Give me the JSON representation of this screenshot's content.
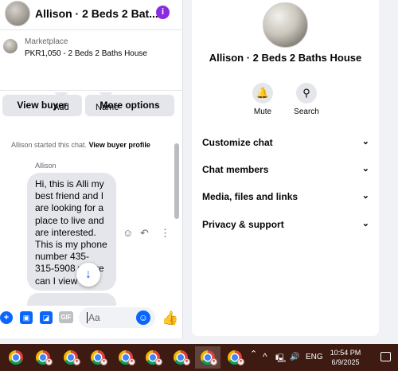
{
  "chat": {
    "title": "Allison · 2 Beds 2 Bat...",
    "listing_label": "Marketplace",
    "listing_text": "PKR1,050 - 2 Beds 2 Baths House",
    "view_buyer": "View buyer",
    "more_options": "More options",
    "add_label": "Add",
    "name_label": "Name",
    "system_text": "Allison started this chat.",
    "system_link": "View buyer profile",
    "sender": "Allison",
    "message": "Hi, this is Alli my best friend and I are looking for a place to live and are interested. This is my phone number 435-315-5908 where can I view it?!",
    "input_placeholder": "Aa",
    "gif_label": "GIF"
  },
  "info": {
    "title": "Allison · 2 Beds 2 Baths House",
    "mute": "Mute",
    "search": "Search",
    "sections": [
      "Customize chat",
      "Chat members",
      "Media, files and links",
      "Privacy & support"
    ]
  },
  "taskbar": {
    "language": "ENG",
    "time": "10:54 PM",
    "date": "6/9/2025"
  },
  "colors": {
    "accent": "#0866ff",
    "info_icon": "#8a2be2",
    "taskbar": "#3d1a12"
  }
}
